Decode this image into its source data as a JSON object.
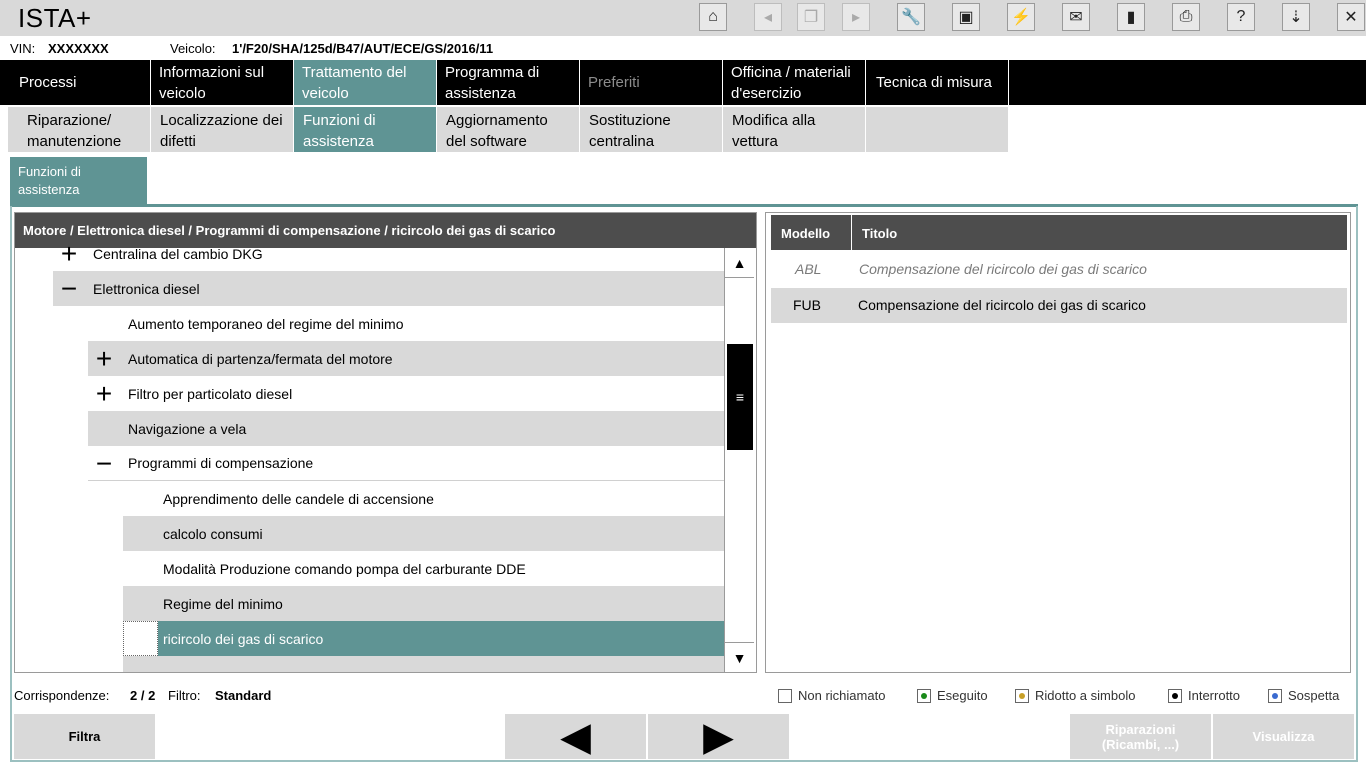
{
  "app_title": "ISTA+",
  "toolbar_icons": [
    "home-icon",
    "back-icon",
    "copy-icon",
    "forward-icon",
    "wrench-icon",
    "id-card-icon",
    "connect-icon",
    "mail-icon",
    "battery-icon",
    "print-icon",
    "help-icon",
    "download-icon",
    "close-icon"
  ],
  "info": {
    "vin_label": "VIN:",
    "vin_value": "XXXXXXX",
    "vehicle_label": "Veicolo:",
    "vehicle_value": "1'/F20/SHA/125d/B47/AUT/ECE/GS/2016/11"
  },
  "nav1": [
    {
      "label": "Processi"
    },
    {
      "label": "Informazioni sul veicolo"
    },
    {
      "label": "Trattamento del veicolo"
    },
    {
      "label": "Programma di assistenza"
    },
    {
      "label": "Preferiti"
    },
    {
      "label": "Officina / materiali d'esercizio"
    },
    {
      "label": "Tecnica di misura"
    }
  ],
  "nav2": [
    {
      "label": "Riparazione/ manutenzione"
    },
    {
      "label": "Localizzazione dei difetti"
    },
    {
      "label": "Funzioni di assistenza"
    },
    {
      "label": "Aggiornamento del software"
    },
    {
      "label": "Sostituzione centralina"
    },
    {
      "label": "Modifica alla vettura"
    }
  ],
  "section_tab": "Funzioni di assistenza",
  "tree": {
    "breadcrumb": "Motore / Elettronica diesel / Programmi di compensazione / ricircolo dei gas di scarico",
    "rows": [
      {
        "label": "Centralina del cambio DKG",
        "icon": "+"
      },
      {
        "label": "Elettronica diesel",
        "icon": "−"
      },
      {
        "label": "Aumento temporaneo del regime del minimo",
        "icon": ""
      },
      {
        "label": "Automatica di partenza/fermata del motore",
        "icon": "+"
      },
      {
        "label": "Filtro per particolato diesel",
        "icon": "+"
      },
      {
        "label": "Navigazione a vela",
        "icon": ""
      },
      {
        "label": "Programmi di compensazione",
        "icon": "−"
      },
      {
        "label": "Apprendimento delle candele di accensione",
        "icon": ""
      },
      {
        "label": "calcolo consumi",
        "icon": ""
      },
      {
        "label": "Modalità Produzione comando pompa del carburante DDE",
        "icon": ""
      },
      {
        "label": "Regime del minimo",
        "icon": ""
      },
      {
        "label": "ricircolo dei gas di scarico",
        "icon": ""
      }
    ]
  },
  "results": {
    "col_model": "Modello",
    "col_title": "Titolo",
    "rows": [
      {
        "model": "ABL",
        "title": "Compensazione del ricircolo dei gas di scarico"
      },
      {
        "model": "FUB",
        "title": "Compensazione del ricircolo dei gas di scarico"
      }
    ]
  },
  "footer": {
    "matches_label": "Corrispondenze:",
    "matches_value": "2 / 2",
    "filter_label": "Filtro:",
    "filter_value": "Standard"
  },
  "legend": [
    {
      "label": "Non richiamato",
      "color": "#ffffff"
    },
    {
      "label": "Eseguito",
      "color": "#1a8a1a"
    },
    {
      "label": "Ridotto a simbolo",
      "color": "#c8a028"
    },
    {
      "label": "Interrotto",
      "color": "#000000"
    },
    {
      "label": "Sospetta",
      "color": "#3a6ad0"
    }
  ],
  "buttons": {
    "filter": "Filtra",
    "prev_icon": "◀",
    "next_icon": "▶",
    "repairs": "Riparazioni (Ricambi, ...)",
    "show": "Visualizza"
  },
  "colors": {
    "accent": "#5f9494",
    "header_dark": "#4d4d4d",
    "nav_black": "#000000",
    "row_gray": "#d9d9d9"
  }
}
